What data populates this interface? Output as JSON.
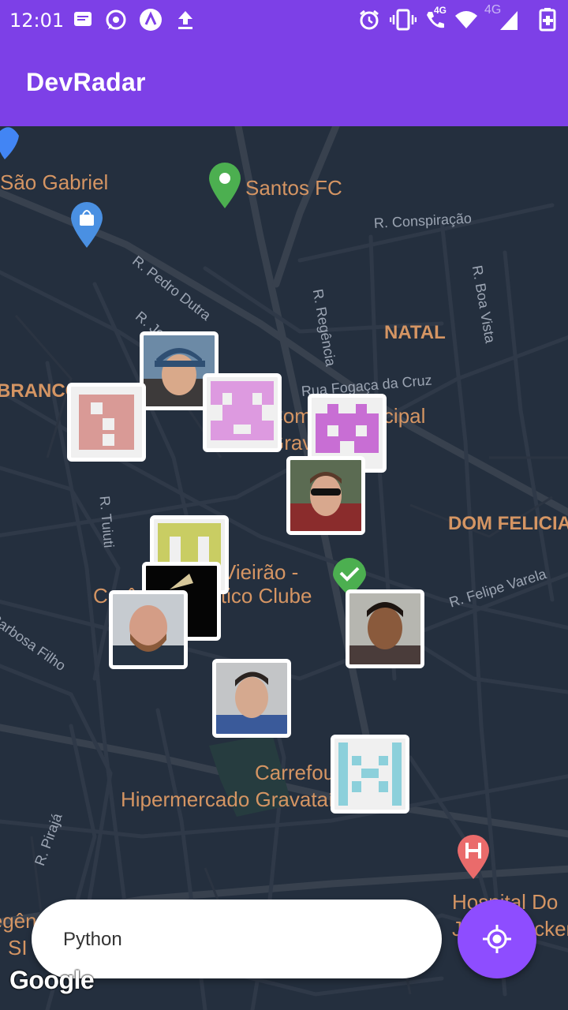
{
  "status_bar": {
    "time": "12:01",
    "icons_left": [
      "message-icon",
      "whatsapp-icon",
      "arrow-app-icon",
      "upload-icon"
    ],
    "icons_right": [
      "alarm-icon",
      "vibrate-icon",
      "volte-call-icon",
      "wifi-icon",
      "signal-icon",
      "battery-charging-icon"
    ],
    "network_label_1": "4G",
    "network_label_2": "4G"
  },
  "app_bar": {
    "title": "DevRadar"
  },
  "map": {
    "places": {
      "sao_gabriel": "São Gabriel",
      "santos_fc": "Santos FC",
      "natal": "NATAL",
      "branco": "BRANCO",
      "dom_felicia": "DOM FELICIA",
      "comite_line1": "Comitê Municipal",
      "comite_line2": "Grava",
      "vieirao_line1": "Estádio Vieirão -",
      "vieirao_line2": "Cerâmica Atlético Clube",
      "carrefour_line1": "Carrefour",
      "carrefour_line2": "Hipermercado Gravataí",
      "hospital_line1": "Hospital Do",
      "hospital_line2": "Jorge Becker",
      "left_bottom_1": "Regên",
      "left_bottom_2": "SI"
    },
    "streets": {
      "conspiracao": "R. Conspiração",
      "pedro_dutra": "R. Pedro Dutra",
      "jorge": "R. Jorge",
      "regencia": "R. Regência",
      "boa_vista": "R. Boa Vista",
      "fogaca": "Rua Fogaça da Cruz",
      "tuiuti": "R. Tuiuti",
      "felipe_varela": "R. Felipe Varela",
      "barbosa": "Barbosa Filho",
      "piraja": "R. Pirajá"
    },
    "accent_color": "#7d40e7",
    "map_bg_color": "#242f3e"
  },
  "search": {
    "value": "Python"
  },
  "attribution": "Google"
}
